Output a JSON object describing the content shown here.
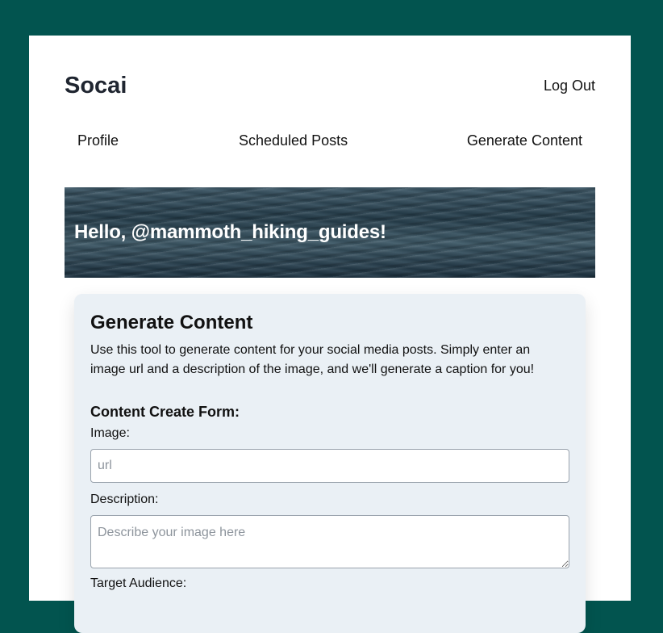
{
  "header": {
    "brand": "Socai",
    "logout_label": "Log Out"
  },
  "nav": {
    "profile": "Profile",
    "scheduled_posts": "Scheduled Posts",
    "generate_content": "Generate Content"
  },
  "hero": {
    "greeting": "Hello, @mammoth_hiking_guides!"
  },
  "generate": {
    "title": "Generate Content",
    "description": "Use this tool to generate content for your social media posts. Simply enter an image url and a description of the image, and we'll generate a caption for you!",
    "form_heading": "Content Create Form:",
    "image_label": "Image:",
    "image_placeholder": "url",
    "image_value": "",
    "description_label": "Description:",
    "description_placeholder": "Describe your image here",
    "description_value": "",
    "audience_label": "Target Audience:"
  },
  "colors": {
    "background": "#02544f",
    "card": "#eaf0f5",
    "brand_text": "#1f2530"
  }
}
